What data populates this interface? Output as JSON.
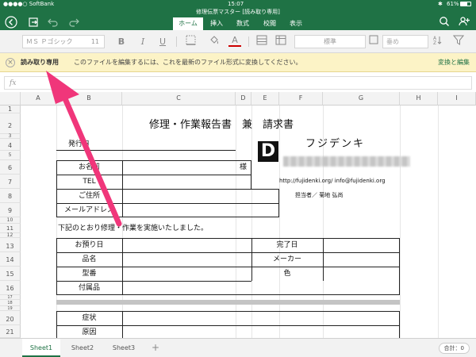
{
  "status_bar": {
    "carrier": "●●●●○ SoftBank",
    "time": "15:07",
    "battery": "61%"
  },
  "title_bar": {
    "document_title": "修理伝票マスター [読み取り専用]"
  },
  "tabs": [
    {
      "label": "ホーム",
      "active": true
    },
    {
      "label": "挿入",
      "active": false
    },
    {
      "label": "数式",
      "active": false
    },
    {
      "label": "校閲",
      "active": false
    },
    {
      "label": "表示",
      "active": false
    }
  ],
  "ribbon": {
    "font_name_placeholder": "ＭＳ Ｐゴシック",
    "font_size": "11",
    "bold": "B",
    "italic": "I",
    "underline": "U",
    "font_color_glyph": "A",
    "number_format": "標準",
    "wrap_label": "垂め"
  },
  "info_bar": {
    "read_only_label": "読み取り専用",
    "message": "このファイルを編集するには、これを最新のファイル形式に変換してください。",
    "convert_button": "変換と編集"
  },
  "formula_bar": {
    "fx_label": "fx",
    "value": ""
  },
  "columns": [
    "A",
    "B",
    "C",
    "D",
    "E",
    "F",
    "G",
    "H",
    "I"
  ],
  "rows": [
    "1",
    "2",
    "3",
    "4",
    "5",
    "6",
    "7",
    "8",
    "9",
    "10",
    "11",
    "12",
    "13",
    "14",
    "15",
    "16",
    "17",
    "18",
    "19",
    "20",
    "21"
  ],
  "sheet": {
    "title": "修理・作業報告書　兼　請求書",
    "issue_date_label": "発行日",
    "company_logo_text": "D",
    "company_name": "フジデンキ",
    "company_url_email": "http://fujidenki.org/  info@fujidenki.org",
    "person_in_charge": "担当者／ 菊地 弘尚",
    "name_label": "お名前",
    "honorific": "様",
    "tel_label": "TEL",
    "address_label": "ご住所",
    "email_label": "メールアドレス",
    "notice": "下記のとおり修理・作業を実施いたしました。",
    "received_date_label": "お預り日",
    "completion_date_label": "完了日",
    "product_name_label": "品名",
    "maker_label": "メーカー",
    "model_label": "型番",
    "color_label": "色",
    "accessories_label": "付属品",
    "symptom_label": "症状",
    "cause_label": "原因"
  },
  "sheet_tabs": [
    {
      "label": "Sheet1",
      "active": true
    },
    {
      "label": "Sheet2",
      "active": false
    },
    {
      "label": "Sheet3",
      "active": false
    }
  ],
  "add_sheet": "+",
  "sum_display": "合計：0",
  "colors": {
    "excel_green": "#1f7245",
    "info_bar_bg": "#fcf3c6",
    "annotation_arrow": "#f0367a"
  }
}
